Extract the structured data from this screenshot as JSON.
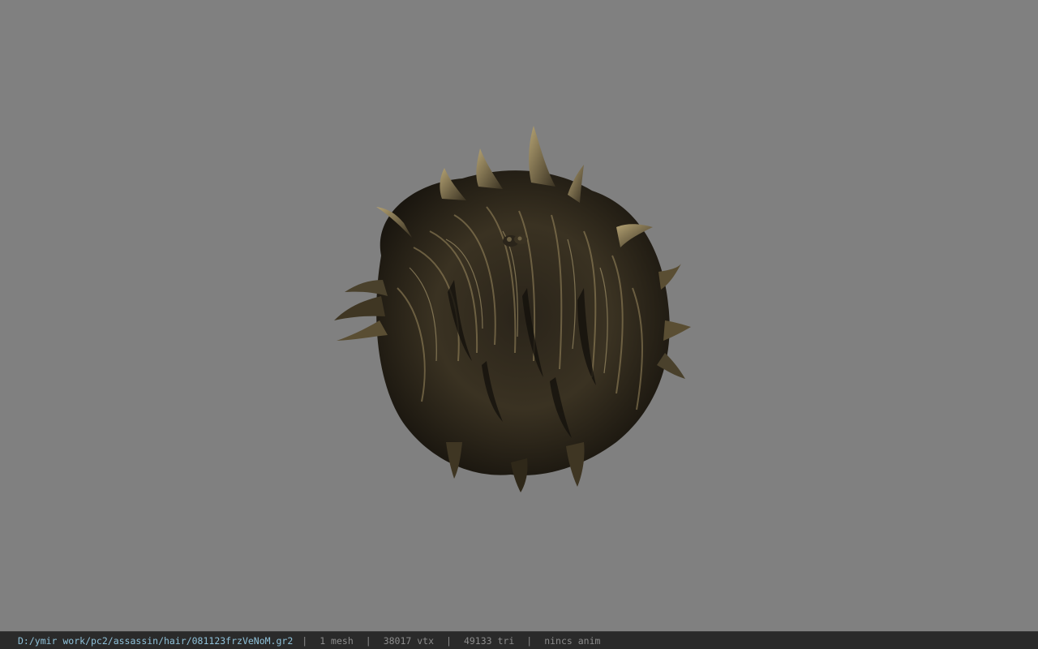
{
  "viewport": {
    "background": "#808080",
    "model": {
      "name": "hair-mesh",
      "colors": {
        "dark": "#1b1812",
        "mid": "#4a412c",
        "light": "#a8976b"
      }
    }
  },
  "statusbar": {
    "file_path": "D:/ymir work/pc2/assassin/hair/081123frzVeNoM.gr2",
    "separator": "|",
    "mesh": "1 mesh",
    "vertices": "38017 vtx",
    "triangles": "49133 tri",
    "anim": "nincs anim"
  }
}
